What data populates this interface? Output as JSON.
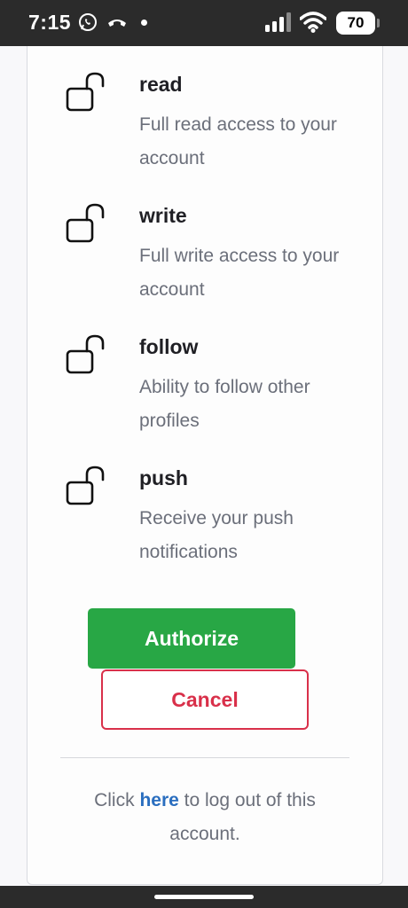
{
  "status_bar": {
    "time": "7:15",
    "battery": "70"
  },
  "scopes": [
    {
      "name": "read",
      "description": "Full read access to your account"
    },
    {
      "name": "write",
      "description": "Full write access to your account"
    },
    {
      "name": "follow",
      "description": "Ability to follow other profiles"
    },
    {
      "name": "push",
      "description": "Receive your push notifications"
    }
  ],
  "actions": {
    "authorize_label": "Authorize",
    "cancel_label": "Cancel"
  },
  "logout": {
    "prefix": "Click ",
    "link_text": "here",
    "suffix": " to log out of this account."
  },
  "colors": {
    "authorize": "#28a745",
    "cancel": "#d9304a",
    "link": "#2a6ebf"
  }
}
